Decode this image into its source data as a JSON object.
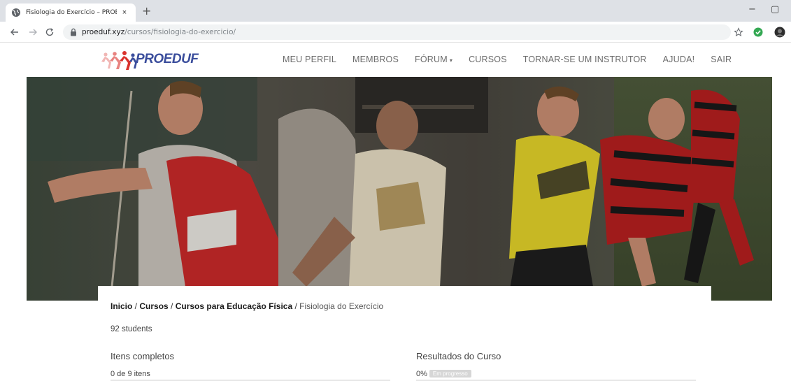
{
  "browser": {
    "tab_title": "Fisiologia do Exercício – PROEDU",
    "tab_close": "×",
    "new_tab": "+",
    "url_host": "proeduf.xyz",
    "url_path": "/cursos/fisiologia-do-exercicio/",
    "minimize": "−",
    "maximize": "▢"
  },
  "site": {
    "logo_text": "PROEDUF",
    "nav": [
      {
        "label": "MEU PERFIL"
      },
      {
        "label": "MEMBROS"
      },
      {
        "label": "FÓRUM"
      },
      {
        "label": "CURSOS"
      },
      {
        "label": "TORNAR-SE UM INSTRUTOR"
      },
      {
        "label": "AJUDA!"
      },
      {
        "label": "SAIR"
      }
    ]
  },
  "breadcrumb": {
    "home": "Inicio",
    "sep": " / ",
    "cursos": "Cursos",
    "categoria": "Cursos para Educação Física",
    "current": "Fisiologia do Exercício"
  },
  "course": {
    "students": "92 students",
    "items_title": "Itens completos",
    "items_value": "0 de 9 itens",
    "results_title": "Resultados do Curso",
    "results_value": "0%",
    "results_badge": "Em progresso",
    "progress_fraction": 0
  },
  "colors": {
    "brand_blue": "#3a4d9c",
    "brand_red": "#d9322c"
  }
}
